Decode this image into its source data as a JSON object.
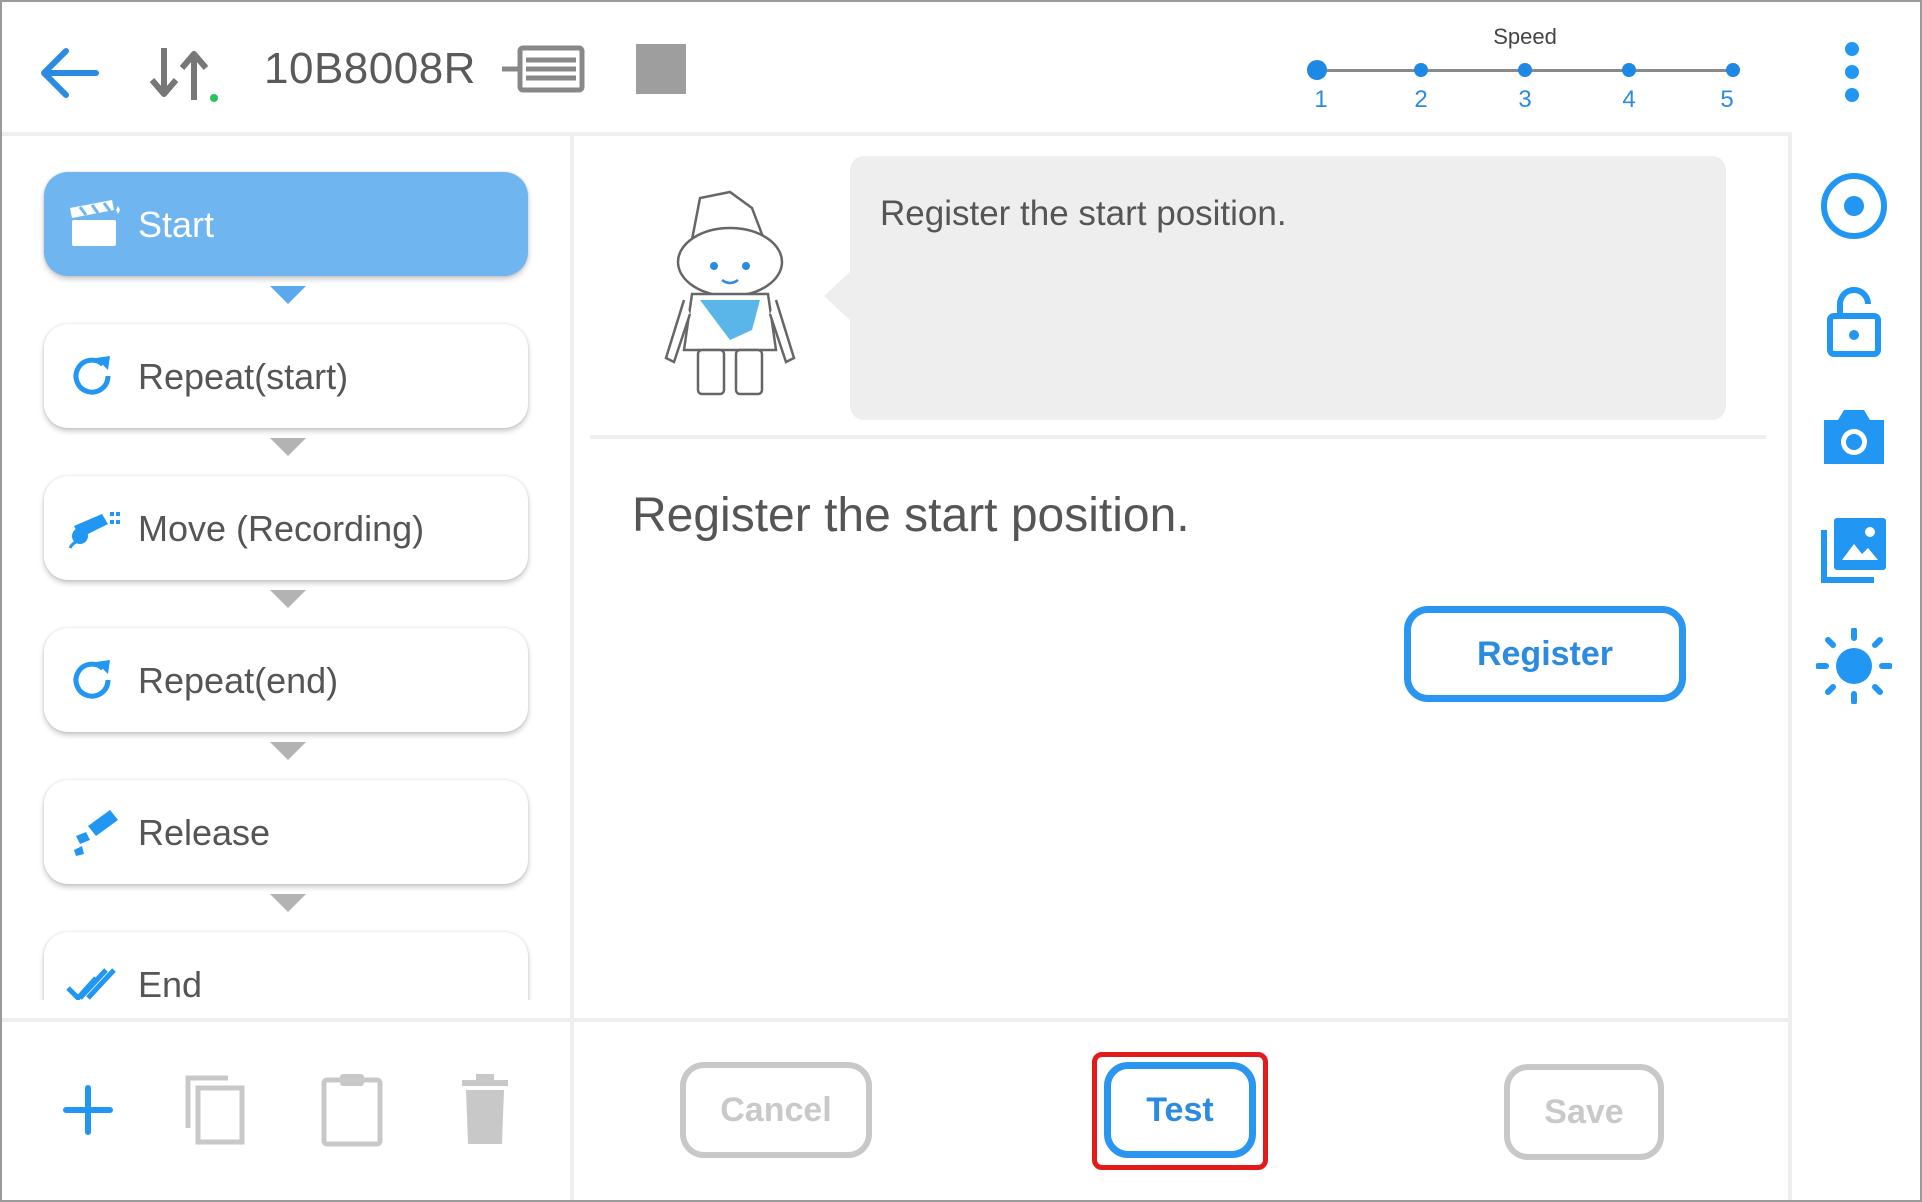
{
  "header": {
    "device_id": "10B8008R",
    "speed": {
      "label": "Speed",
      "levels": [
        "1",
        "2",
        "3",
        "4",
        "5"
      ],
      "selected": "1"
    }
  },
  "steps": [
    {
      "label": "Start",
      "icon": "clapperboard-icon",
      "active": true
    },
    {
      "label": "Repeat(start)",
      "icon": "repeat-icon",
      "active": false
    },
    {
      "label": "Move (Recording)",
      "icon": "robot-arm-record-icon",
      "active": false
    },
    {
      "label": "Repeat(end)",
      "icon": "repeat-icon",
      "active": false
    },
    {
      "label": "Release",
      "icon": "gripper-release-icon",
      "active": false
    },
    {
      "label": "End",
      "icon": "double-check-icon",
      "active": false
    }
  ],
  "main": {
    "bubble_text": "Register the start position.",
    "instruction": "Register the start position.",
    "register_label": "Register"
  },
  "footer": {
    "cancel_label": "Cancel",
    "test_label": "Test",
    "save_label": "Save"
  },
  "colors": {
    "accent": "#2196f3",
    "active_step": "#6fb5f0",
    "disabled": "#c8c8c8",
    "highlight": "#e31a1a"
  }
}
